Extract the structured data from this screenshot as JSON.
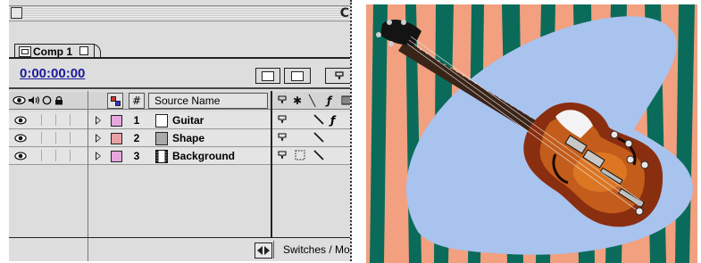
{
  "comp_tab": {
    "label": "Comp 1"
  },
  "timecode": "0:00:00:00",
  "columns": {
    "number": "#",
    "source_name": "Source Name",
    "hdr_switch_icons": [
      "⊕",
      "✱",
      "╲",
      "ƒ"
    ]
  },
  "layers": [
    {
      "number": "1",
      "name": "Guitar",
      "label_color": "#e7a6dd",
      "icon": "solid",
      "switch_f": "ƒ"
    },
    {
      "number": "2",
      "name": "Shape",
      "label_color": "#e9a0a3",
      "icon": "solid-gray",
      "switch_f": ""
    },
    {
      "number": "3",
      "name": "Background",
      "label_color": "#e7a6dd",
      "icon": "footage",
      "switch_f": ""
    }
  ],
  "bottom": {
    "switches_label": "Switches / Mo"
  },
  "colors": {
    "timecode": "#1b1b9a",
    "stripe_green": "#0b6b5a",
    "stripe_salmon": "#f2a07f",
    "blob": "#a8c3ee"
  },
  "composition": {
    "subject": "electric guitar over blue shape on green and salmon striped background"
  }
}
